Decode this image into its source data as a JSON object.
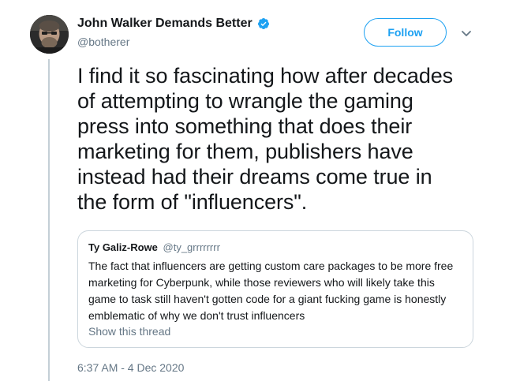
{
  "author": {
    "name": "John Walker Demands Better",
    "handle": "@botherer",
    "verified": true
  },
  "actions": {
    "follow_label": "Follow",
    "more_icon": "chevron-down-icon"
  },
  "tweet": {
    "text_lines": [
      "I find it so fascinating how after decades",
      "of attempting to wrangle the gaming",
      "press into something that does their",
      "marketing for them, publishers have",
      "instead had their dreams come true in",
      "the form of \"influencers\"."
    ],
    "timestamp": "6:37 AM - 4 Dec 2020"
  },
  "quoted_tweet": {
    "name": "Ty Galiz-Rowe",
    "handle": "@ty_grrrrrrrr",
    "text_lines": [
      "The fact that influencers are getting custom care packages to be more free",
      "marketing for Cyberpunk, while those reviewers who will likely take this",
      "game to task still haven't gotten code for a giant fucking game is honestly",
      "emblematic of why we don't trust influencers"
    ],
    "show_thread_label": "Show this thread"
  },
  "colors": {
    "accent": "#1da1f2",
    "secondary_text": "#657786",
    "border": "#ccd6dd"
  }
}
